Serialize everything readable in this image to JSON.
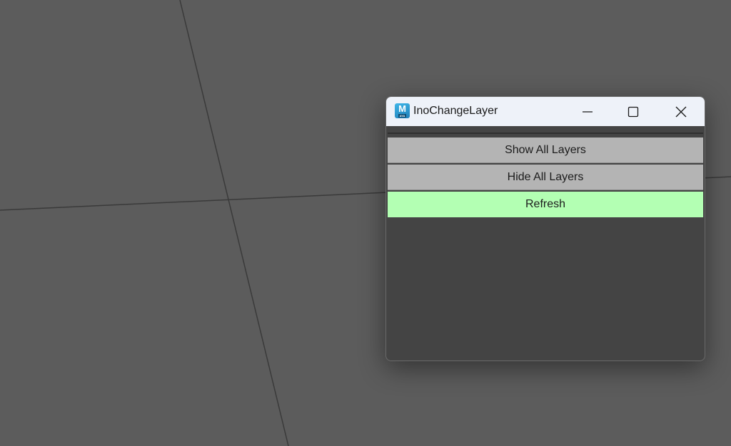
{
  "window": {
    "title": "InoChangeLayer",
    "app_icon": {
      "name": "maya-app-icon",
      "letter": "M",
      "tag": "AYA"
    }
  },
  "buttons": {
    "show_all": "Show All Layers",
    "hide_all": "Hide All Layers",
    "refresh": "Refresh"
  },
  "colors": {
    "refresh_button": "#b3ffb3",
    "layer_button": "#b4b4b4",
    "window_body": "#444444",
    "viewport": "#5c5c5c"
  }
}
